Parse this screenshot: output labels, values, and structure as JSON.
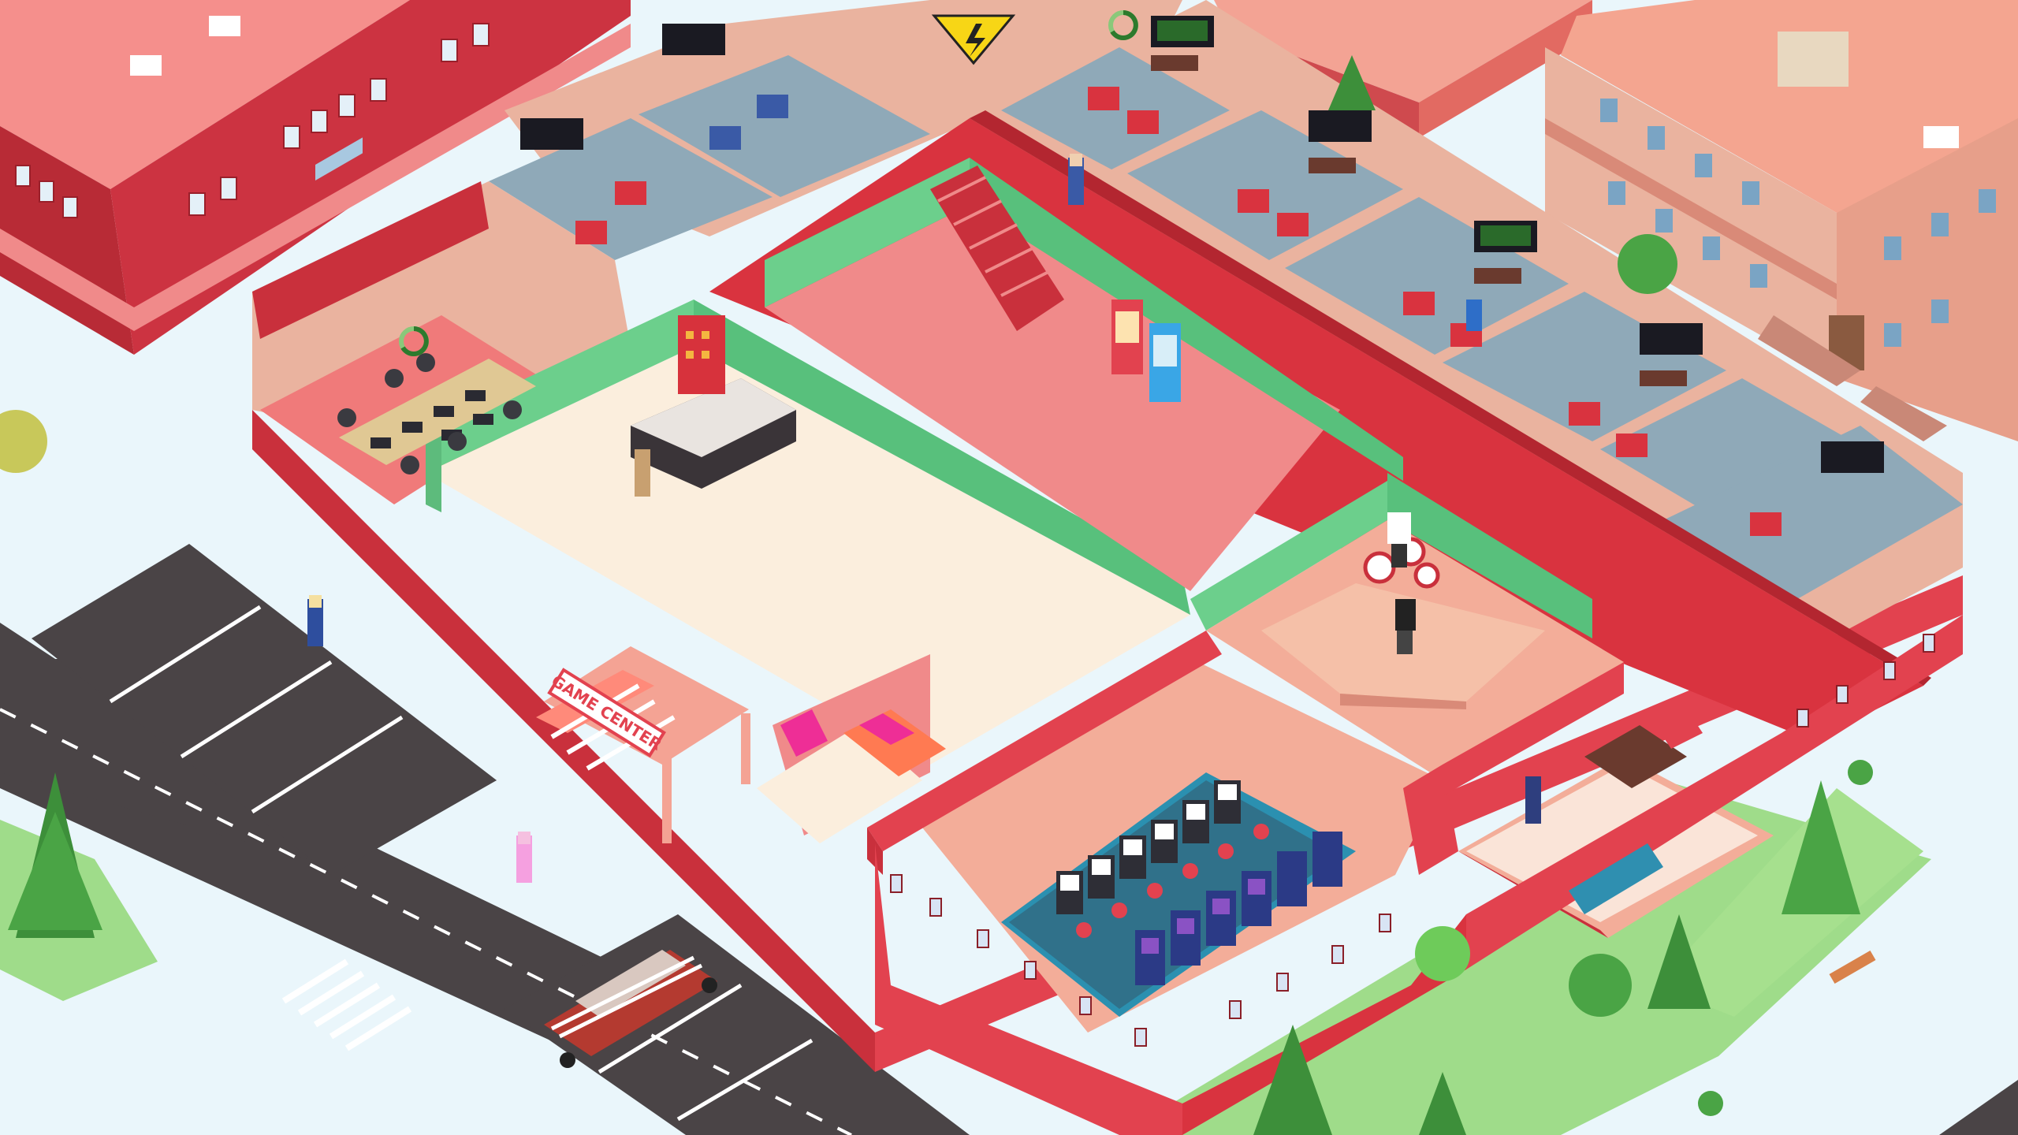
{
  "scene": {
    "type": "isometric-idle-game",
    "palette": {
      "ground": "#eaf6fb",
      "grass": "#9fdc8a",
      "road": "#4a4446",
      "road_marking": "#ffffff",
      "building_red": "#c9303c",
      "building_pink": "#f0968a",
      "wall_salmon": "#eab39f",
      "floor_cream": "#fbeedd",
      "floor_pink": "#f08a8a",
      "floor_peach": "#f3ad99",
      "wall_green": "#6ccf8c",
      "office_floor": "#8fa9b8",
      "outer_wall": "#e2424f",
      "hazard_yellow": "#f7d616"
    }
  },
  "sign": {
    "text": "GAME CENTER"
  },
  "icons": [
    "warning-sign-icon",
    "progress-ring-icon"
  ]
}
